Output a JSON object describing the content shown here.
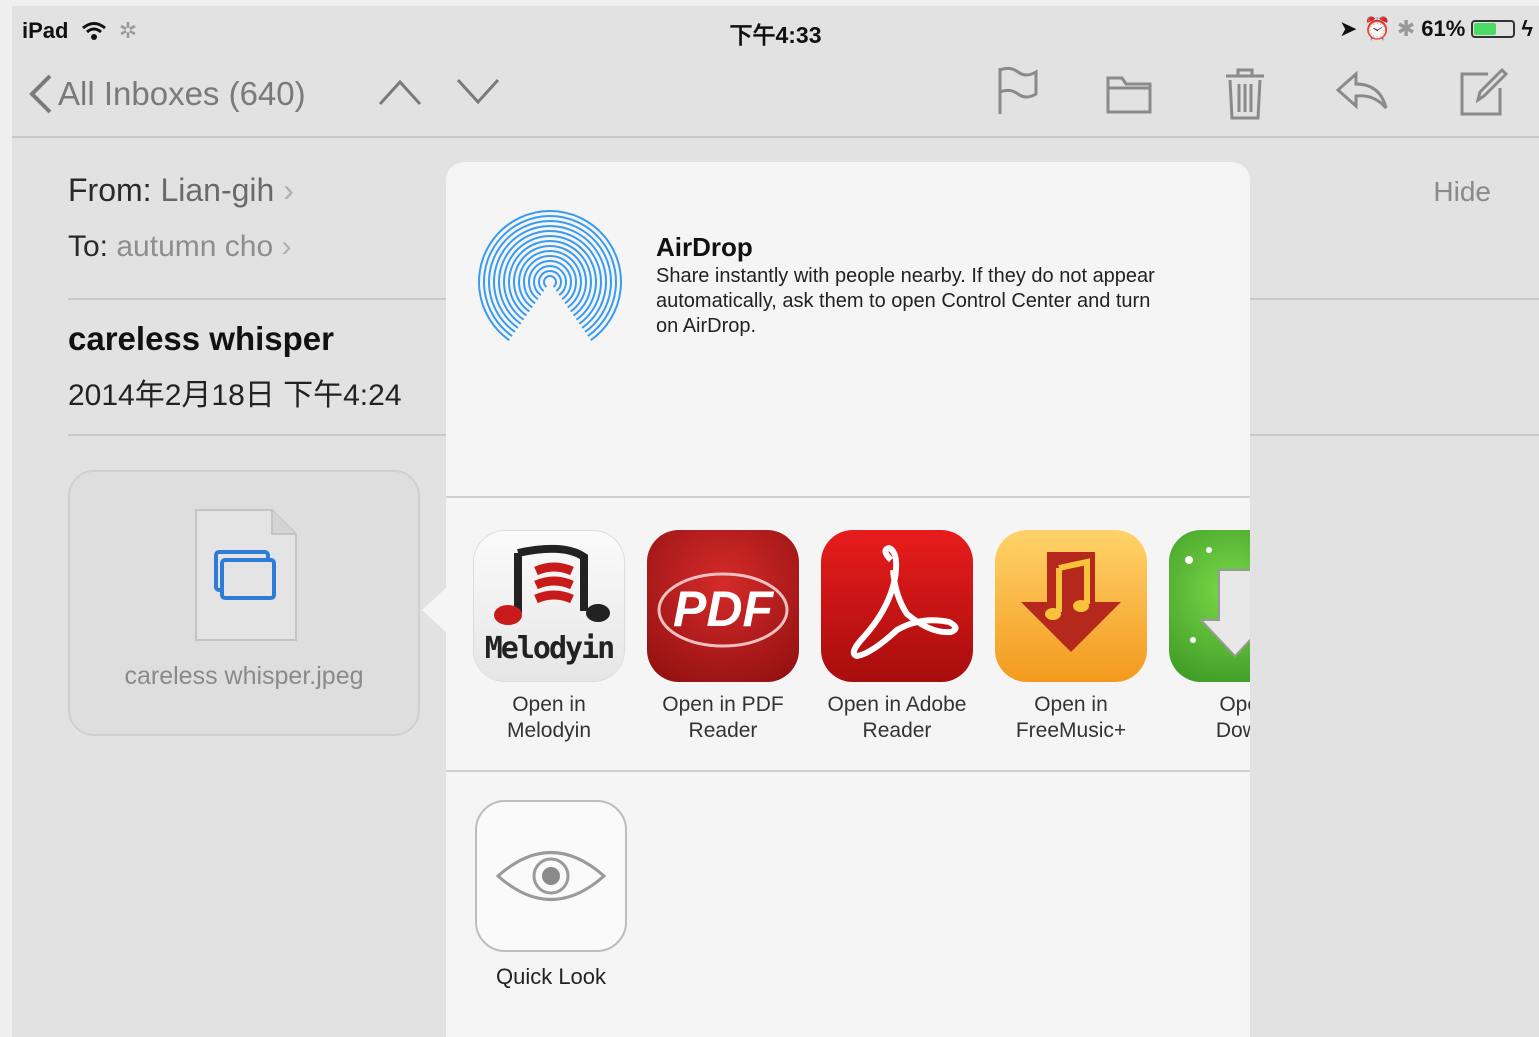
{
  "status_bar": {
    "carrier": "iPad",
    "time": "下午4:33",
    "battery": "61%",
    "battery_level": 0.61
  },
  "navbar": {
    "back_label": "All Inboxes (640)"
  },
  "message": {
    "from_label": "From:",
    "from_value": "Lian-gih",
    "to_label": "To:",
    "to_value": "autumn cho",
    "hide_label": "Hide",
    "subject": "careless whisper",
    "date": "2014年2月18日 下午4:24",
    "attachment_name": "careless whisper.jpeg"
  },
  "share_sheet": {
    "airdrop_title": "AirDrop",
    "airdrop_description": "Share instantly with people nearby. If they do not appear automatically, ask them to open Control Center and turn on AirDrop.",
    "apps": [
      {
        "line1": "Open in",
        "line2": "Melodyin",
        "icon_text": "Melodyin"
      },
      {
        "line1": "Open in PDF",
        "line2": "Reader",
        "icon_text": "PDF"
      },
      {
        "line1": "Open in Adobe",
        "line2": "Reader"
      },
      {
        "line1": "Open in",
        "line2": "FreeMusic+"
      },
      {
        "line1": "Open",
        "line2": "Downl"
      }
    ],
    "quick_look_label": "Quick Look"
  },
  "colors": {
    "screen_bg": "#e2e2e2",
    "sheet_bg": "#f5f5f5",
    "airdrop_blue": "#3a9bf0",
    "battery_green": "#4cd964"
  }
}
